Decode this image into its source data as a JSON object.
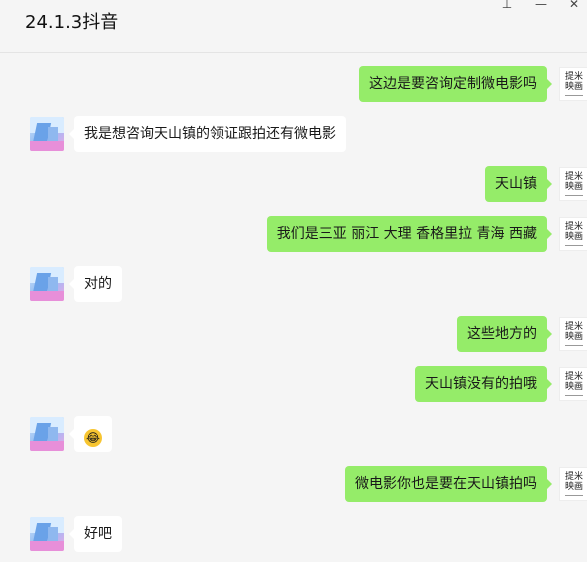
{
  "header": {
    "title": "24.1.3抖音",
    "pin_glyph": "⊥",
    "minimize_glyph": "—",
    "close_glyph": "✕"
  },
  "contacts": {
    "self_avatar_text": [
      "提米",
      "映画"
    ]
  },
  "messages": [
    {
      "side": "right",
      "text": "这边是要咨询定制微电影吗"
    },
    {
      "side": "left",
      "text": "我是想咨询天山镇的领证跟拍还有微电影"
    },
    {
      "side": "right",
      "text": "天山镇"
    },
    {
      "side": "right",
      "text": "我们是三亚 丽江 大理 香格里拉 青海 西藏"
    },
    {
      "side": "left",
      "text": "对的"
    },
    {
      "side": "right",
      "text": "这些地方的"
    },
    {
      "side": "right",
      "text": "天山镇没有的拍哦"
    },
    {
      "side": "left",
      "text": "😂"
    },
    {
      "side": "right",
      "text": "微电影你也是要在天山镇拍吗"
    },
    {
      "side": "left",
      "text": "好吧"
    }
  ]
}
